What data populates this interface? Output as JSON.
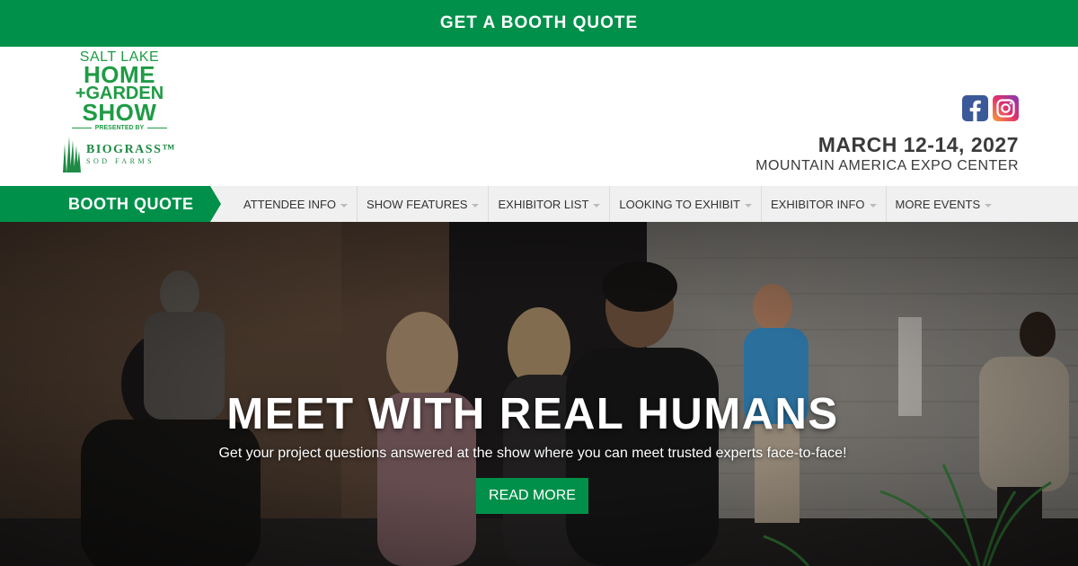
{
  "top_banner": {
    "label": "GET A BOOTH QUOTE"
  },
  "logo": {
    "line1": "SALT LAKE",
    "line2": "HOME",
    "line3": "+GARDEN",
    "line4": "SHOW",
    "presented_by": "PRESENTED BY",
    "sponsor_name": "BIOGRASS™",
    "sponsor_sub": "SOD FARMS"
  },
  "social": {
    "icons": [
      "facebook-icon",
      "instagram-icon"
    ]
  },
  "event": {
    "dates": "MARCH 12-14, 2027",
    "venue": "MOUNTAIN AMERICA EXPO CENTER"
  },
  "nav": {
    "booth_quote": "BOOTH QUOTE",
    "items": [
      {
        "label": "ATTENDEE INFO"
      },
      {
        "label": "SHOW FEATURES"
      },
      {
        "label": "EXHIBITOR LIST"
      },
      {
        "label": "LOOKING TO EXHIBIT"
      },
      {
        "label": "EXHIBITOR INFO"
      },
      {
        "label": "MORE EVENTS"
      }
    ]
  },
  "hero": {
    "title": "MEET WITH REAL HUMANS",
    "subtitle": "Get your project questions answered at the show where you can meet trusted experts face-to-face!",
    "button": "READ MORE"
  },
  "colors": {
    "brand_green": "#00904a",
    "logo_green": "#1f9b45",
    "nav_bg": "#f0f0f0",
    "text_dark": "#3a3a3a"
  }
}
